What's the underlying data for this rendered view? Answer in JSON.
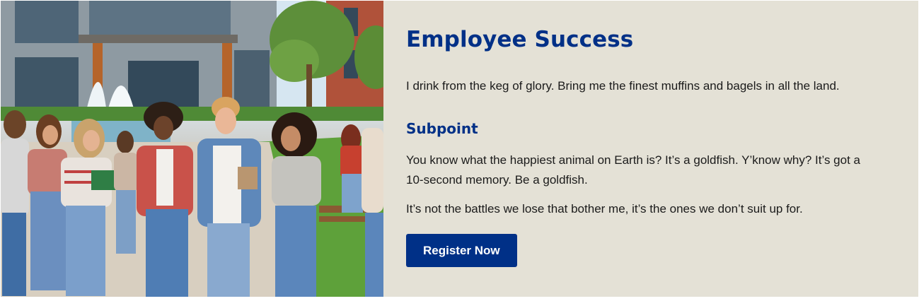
{
  "hero": {
    "image_icon": "campus-students-illustration"
  },
  "content": {
    "title": "Employee Success",
    "lead": "I drink from the keg of glory. Bring me the finest muffins and bagels in all the land.",
    "subtitle": "Subpoint",
    "paragraphs": [
      "You know what the happiest animal on Earth is? It’s a goldfish. Y’know why? It’s got a 10-second memory. Be a goldfish.",
      "It’s not the battles we lose that bother me, it’s the ones we don’t suit up for."
    ],
    "button_label": "Register Now"
  },
  "colors": {
    "brand": "#003087",
    "panel": "#e4e1d6"
  }
}
